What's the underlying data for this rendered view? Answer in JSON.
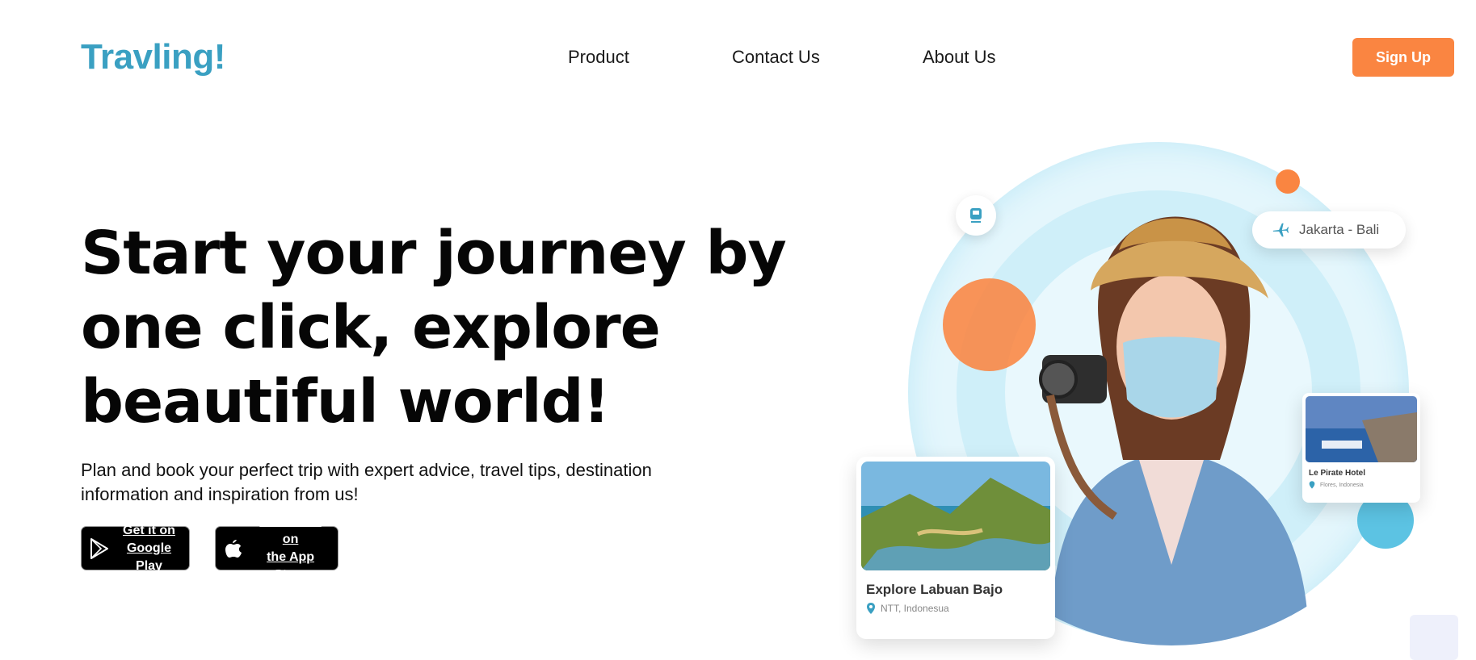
{
  "brand": {
    "logo": "Travling!"
  },
  "nav": {
    "items": [
      "Product",
      "Contact Us",
      "About Us"
    ]
  },
  "header": {
    "signup_label": "Sign Up"
  },
  "hero": {
    "headline_lines": [
      "Start your journey by",
      "one click, explore",
      "beautiful world!"
    ],
    "subtitle_lines": [
      "Plan and book your perfect trip with expert advice, travel tips, destination",
      "information and inspiration from us!"
    ]
  },
  "stores": {
    "google": {
      "line1": "Get it on",
      "line2": "Google Play",
      "icon": "google-play-icon"
    },
    "apple": {
      "line1": "Download on",
      "line2": "the App Store",
      "icon": "apple-icon"
    }
  },
  "route_pill": {
    "label": "Jakarta - Bali",
    "icon": "airplane-icon"
  },
  "labuan_card": {
    "title": "Explore Labuan Bajo",
    "location": "NTT, Indonesua"
  },
  "hotel_card": {
    "title": "Le Pirate Hotel",
    "location": "Flores, Indonesia"
  },
  "colors": {
    "accent": "#fa8541",
    "brand": "#3aa0c2",
    "ring_light": "#e4f6fc",
    "ring_mid": "#c8eef9"
  }
}
